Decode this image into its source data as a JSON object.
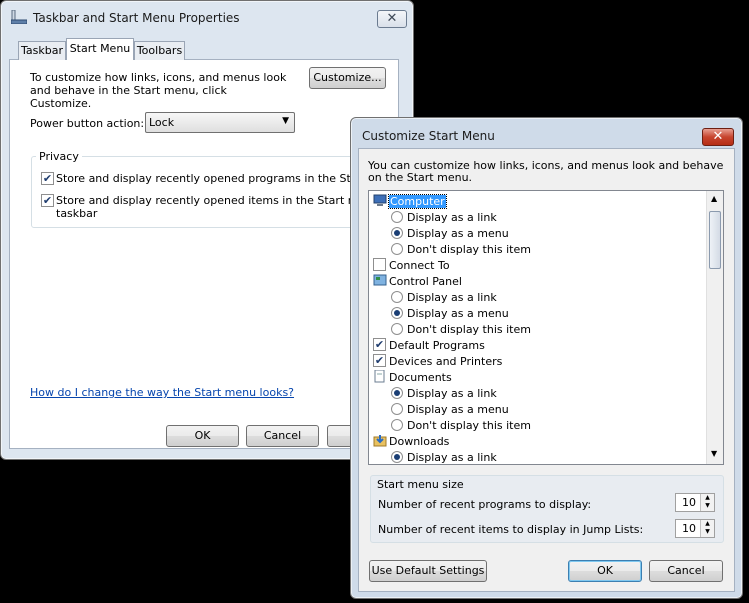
{
  "back_window": {
    "title": "Taskbar and Start Menu Properties",
    "tabs": [
      "Taskbar",
      "Start Menu",
      "Toolbars"
    ],
    "intro": "To customize how links, icons, and menus look and behave in the Start menu, click Customize.",
    "customize_label": "Customize...",
    "power_label": "Power button action:",
    "power_value": "Lock",
    "privacy_label": "Privacy",
    "privacy_1": "Store and display recently opened programs in the Start menu",
    "privacy_2_line1": "Store and display recently opened items in the Start menu and the",
    "privacy_2_line2": "taskbar",
    "help_link": "How do I change the way the Start menu looks?",
    "ok_label": "OK",
    "cancel_label": "Cancel"
  },
  "front_window": {
    "title": "Customize Start Menu",
    "intro": "You can customize how links, icons, and menus look and behave on the Start menu.",
    "items": [
      {
        "kind": "icon",
        "text": "Computer",
        "checked": false,
        "selected": true,
        "icon": "computer-icon"
      },
      {
        "kind": "radio",
        "text": "Display as a link",
        "checked": false
      },
      {
        "kind": "radio",
        "text": "Display as a menu",
        "checked": true
      },
      {
        "kind": "radio",
        "text": "Don't display this item",
        "checked": false
      },
      {
        "kind": "check",
        "text": "Connect To",
        "checked": false
      },
      {
        "kind": "icon",
        "text": "Control Panel",
        "icon": "control-panel-icon"
      },
      {
        "kind": "radio",
        "text": "Display as a link",
        "checked": false
      },
      {
        "kind": "radio",
        "text": "Display as a menu",
        "checked": true
      },
      {
        "kind": "radio",
        "text": "Don't display this item",
        "checked": false
      },
      {
        "kind": "check",
        "text": "Default Programs",
        "checked": true
      },
      {
        "kind": "check",
        "text": "Devices and Printers",
        "checked": true
      },
      {
        "kind": "icon",
        "text": "Documents",
        "icon": "documents-icon"
      },
      {
        "kind": "radio",
        "text": "Display as a link",
        "checked": true
      },
      {
        "kind": "radio",
        "text": "Display as a menu",
        "checked": false
      },
      {
        "kind": "radio",
        "text": "Don't display this item",
        "checked": false
      },
      {
        "kind": "icon",
        "text": "Downloads",
        "icon": "downloads-icon"
      },
      {
        "kind": "radio",
        "text": "Display as a link",
        "checked": true
      }
    ],
    "size_group": "Start menu size",
    "recent_programs_label": "Number of recent programs to display:",
    "recent_programs_value": "10",
    "recent_items_label": "Number of recent items to display in Jump Lists:",
    "recent_items_value": "10",
    "default_label": "Use Default Settings",
    "ok_label": "OK",
    "cancel_label": "Cancel"
  }
}
